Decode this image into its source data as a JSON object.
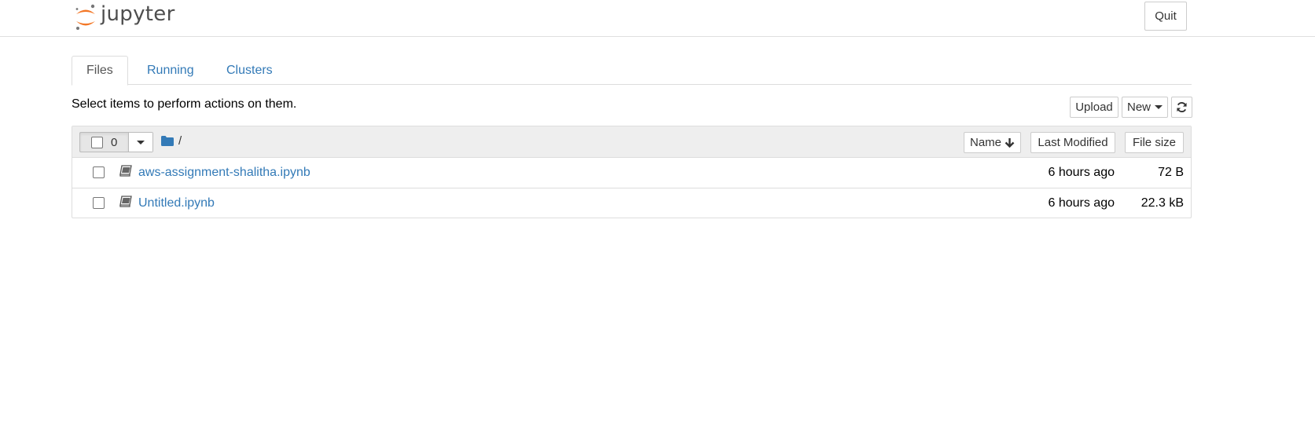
{
  "header": {
    "logo_text": "jupyter",
    "quit_label": "Quit"
  },
  "tabs": [
    {
      "label": "Files",
      "active": true
    },
    {
      "label": "Running",
      "active": false
    },
    {
      "label": "Clusters",
      "active": false
    }
  ],
  "toolbar": {
    "hint": "Select items to perform actions on them.",
    "upload_label": "Upload",
    "new_label": "New",
    "refresh_icon": "refresh-icon"
  },
  "file_list": {
    "selected_count": "0",
    "breadcrumb_path": "/",
    "sort_name_label": "Name",
    "sort_modified_label": "Last Modified",
    "sort_size_label": "File size",
    "rows": [
      {
        "name": "aws-assignment-shalitha.ipynb",
        "modified": "6 hours ago",
        "size": "72 B"
      },
      {
        "name": "Untitled.ipynb",
        "modified": "6 hours ago",
        "size": "22.3 kB"
      }
    ]
  },
  "colors": {
    "link": "#337ab7",
    "logo_orange": "#f37726",
    "logo_gray": "#767677",
    "header_bg": "#eeeeee"
  }
}
